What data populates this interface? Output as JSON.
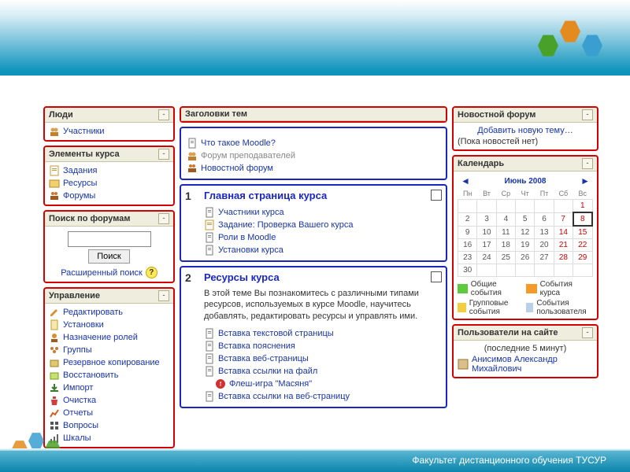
{
  "banner": {
    "cubes": [
      "#4aa12a",
      "#e38b1e",
      "#3a9fd0"
    ]
  },
  "col1": {
    "people": {
      "title": "Люди",
      "items": [
        {
          "ic": "people",
          "t": "Участники"
        }
      ]
    },
    "elements": {
      "title": "Элементы курса",
      "items": [
        {
          "ic": "assign",
          "t": "Задания"
        },
        {
          "ic": "res",
          "t": "Ресурсы"
        },
        {
          "ic": "forum",
          "t": "Форумы"
        }
      ]
    },
    "search": {
      "title": "Поиск по форумам",
      "btn": "Поиск",
      "adv": "Расширенный поиск"
    },
    "admin": {
      "title": "Управление",
      "items": [
        {
          "ic": "edit",
          "t": "Редактировать"
        },
        {
          "ic": "settings",
          "t": "Установки"
        },
        {
          "ic": "roles",
          "t": "Назначение ролей"
        },
        {
          "ic": "groups",
          "t": "Группы"
        },
        {
          "ic": "backup",
          "t": "Резервное копирование"
        },
        {
          "ic": "restore",
          "t": "Восстановить"
        },
        {
          "ic": "import",
          "t": "Импорт"
        },
        {
          "ic": "clean",
          "t": "Очистка"
        },
        {
          "ic": "reports",
          "t": "Отчеты"
        },
        {
          "ic": "questions",
          "t": "Вопросы"
        },
        {
          "ic": "scales",
          "t": "Шкалы"
        }
      ]
    }
  },
  "col2": {
    "header": "Заголовки тем",
    "intro": [
      {
        "ic": "page",
        "t": "Что такое Moodle?",
        "c": "link"
      },
      {
        "ic": "people",
        "t": "Форум преподавателей",
        "c": "mut"
      },
      {
        "ic": "forum",
        "t": "Новостной форум",
        "c": "link"
      }
    ],
    "t1": {
      "num": "1",
      "title": "Главная страница курса",
      "items": [
        {
          "ic": "page",
          "t": "Участники курса"
        },
        {
          "ic": "assign",
          "t": "Задание: Проверка Вашего курса"
        },
        {
          "ic": "page",
          "t": "Роли в Moodle"
        },
        {
          "ic": "page",
          "t": "Установки курса"
        }
      ]
    },
    "t2": {
      "num": "2",
      "title": "Ресурсы курса",
      "desc": "В этой теме Вы познакомитесь с различными типами ресурсов, используемых в курсе Moodle, научитесь добавлять, редактировать ресурсы и управлять ими.",
      "items": [
        {
          "ic": "page",
          "t": "Вставка текстовой страницы"
        },
        {
          "ic": "page",
          "t": "Вставка пояснения"
        },
        {
          "ic": "page",
          "t": "Вставка веб-страницы"
        },
        {
          "ic": "page",
          "t": "Вставка ссылки на файл"
        },
        {
          "ic": "flash",
          "t": "Флеш-игра \"Масяня\"",
          "indent": true
        },
        {
          "ic": "page",
          "t": "Вставка ссылки на веб-страницу"
        }
      ]
    }
  },
  "col3": {
    "news": {
      "title": "Новостной форум",
      "add": "Добавить новую тему…",
      "empty": "(Пока новостей нет)"
    },
    "cal": {
      "title": "Календарь",
      "month": "Июнь 2008",
      "dows": [
        "Пн",
        "Вт",
        "Ср",
        "Чт",
        "Пт",
        "Сб",
        "Вс"
      ],
      "weeks": [
        [
          "",
          "",
          "",
          "",
          "",
          "",
          "1"
        ],
        [
          "2",
          "3",
          "4",
          "5",
          "6",
          "7",
          "8"
        ],
        [
          "9",
          "10",
          "11",
          "12",
          "13",
          "14",
          "15"
        ],
        [
          "16",
          "17",
          "18",
          "19",
          "20",
          "21",
          "22"
        ],
        [
          "23",
          "24",
          "25",
          "26",
          "27",
          "28",
          "29"
        ],
        [
          "30",
          "",
          "",
          "",
          "",
          "",
          ""
        ]
      ],
      "today": "8",
      "legend": [
        {
          "c": "g",
          "t": "Общие события"
        },
        {
          "c": "o",
          "t": "События курса"
        },
        {
          "c": "y",
          "t": "Групповые события"
        },
        {
          "c": "b",
          "t": "События пользователя"
        }
      ]
    },
    "online": {
      "title": "Пользователи на сайте",
      "sub": "(последние 5 минут)",
      "user": "Анисимов Александр Михайлович"
    }
  },
  "footer": "Факультет дистанционного обучения ТУСУР",
  "deccubes": [
    "#e38b1e",
    "#3a9fd0",
    "#4aa12a"
  ]
}
